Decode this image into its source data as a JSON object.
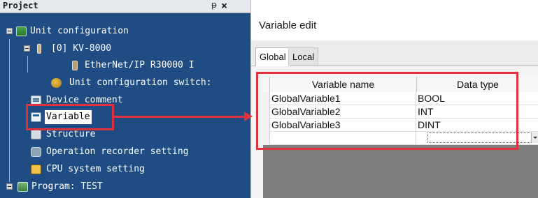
{
  "project_pane": {
    "title": "Project",
    "items": [
      {
        "label": "Unit configuration"
      },
      {
        "label": "[0]  KV-8000"
      },
      {
        "label": "EtherNet/IP   R30000  I"
      },
      {
        "label": "Unit configuration switch:"
      },
      {
        "label": "Device comment"
      },
      {
        "label": "Variable"
      },
      {
        "label": "Structure"
      },
      {
        "label": "Operation recorder setting"
      },
      {
        "label": "CPU system setting"
      },
      {
        "label": "Program: TEST"
      }
    ]
  },
  "editor": {
    "title": "Variable edit",
    "tabs": [
      {
        "label": "Global"
      },
      {
        "label": "Local"
      }
    ],
    "columns": {
      "name": "Variable name",
      "type": "Data type"
    },
    "rows": [
      {
        "name": "GlobalVariable1",
        "type": "BOOL"
      },
      {
        "name": "GlobalVariable2",
        "type": "INT"
      },
      {
        "name": "GlobalVariable3",
        "type": "DINT"
      }
    ]
  },
  "colors": {
    "highlight": "#e0313d",
    "tree_bg": "#1f4c82"
  }
}
